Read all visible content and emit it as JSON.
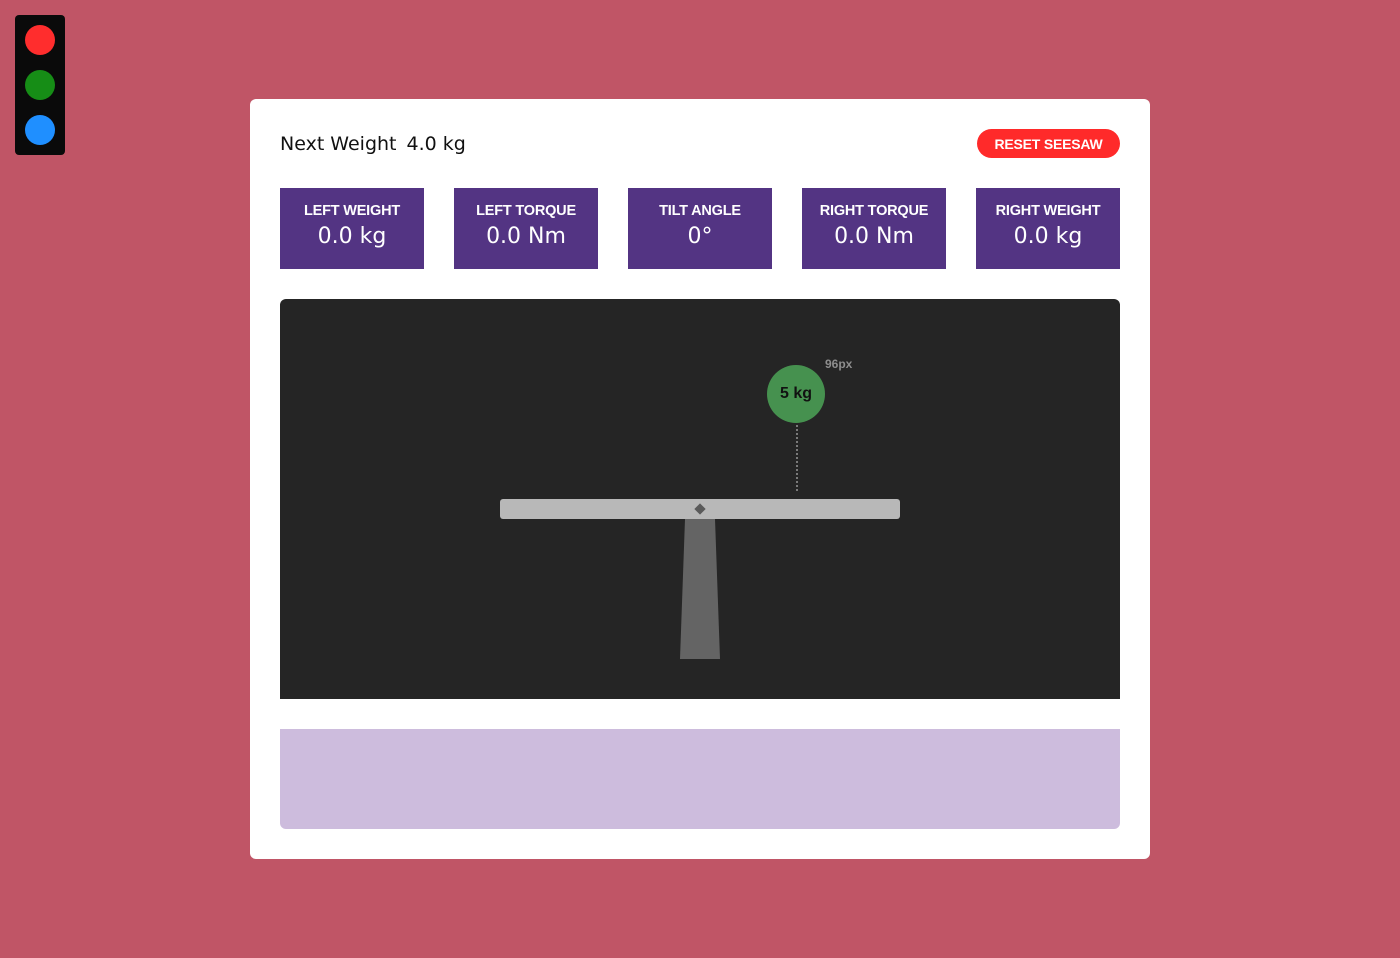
{
  "traffic_lights": {
    "colors": [
      "#ff2d2d",
      "#168d16",
      "#1f8fff"
    ]
  },
  "header": {
    "next_weight_label": "Next Weight",
    "next_weight_value": "4.0 kg",
    "reset_label": "RESET SEESAW"
  },
  "stats": [
    {
      "label": "LEFT WEIGHT",
      "value": "0.0 kg"
    },
    {
      "label": "LEFT TORQUE",
      "value": "0.0 Nm"
    },
    {
      "label": "TILT ANGLE",
      "value": "0°"
    },
    {
      "label": "RIGHT TORQUE",
      "value": "0.0 Nm"
    },
    {
      "label": "RIGHT WEIGHT",
      "value": "0.0 kg"
    }
  ],
  "seesaw": {
    "preview_weight_label": "5 kg",
    "preview_distance_label": "96px",
    "tilt_angle_deg": 0
  },
  "colors": {
    "background": "#c05566",
    "stat_box": "#533483",
    "reset_button": "#ff2a2a",
    "stage": "#252525",
    "plank": "#b8b8b8",
    "preview_ball": "#46914f",
    "log_panel": "#cdbcdd"
  },
  "log": {
    "entries": []
  }
}
